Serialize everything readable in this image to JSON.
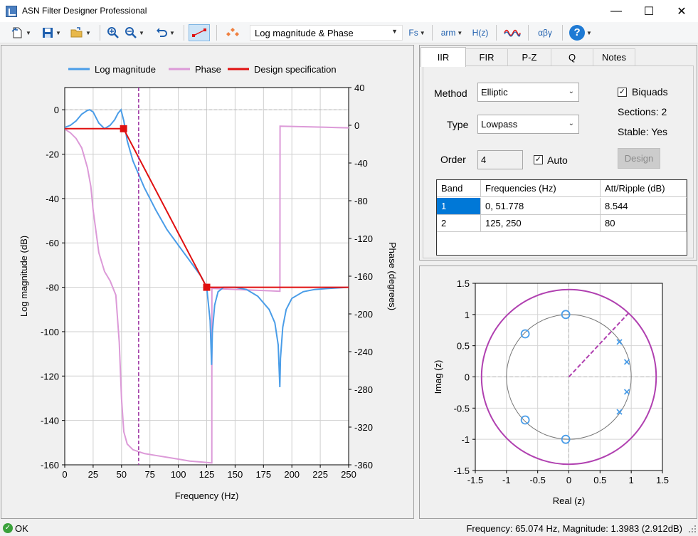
{
  "window": {
    "title": "ASN Filter Designer Professional"
  },
  "toolbar": {
    "view_mode": "Log magnitude & Phase",
    "fs_label": "Fs",
    "arm_label": "arm",
    "hz_label": "H(z)",
    "greek_label": "αβγ",
    "help_label": "?"
  },
  "tabs": [
    "IIR",
    "FIR",
    "P-Z",
    "Q",
    "Notes"
  ],
  "iir": {
    "method_label": "Method",
    "method_value": "Elliptic",
    "type_label": "Type",
    "type_value": "Lowpass",
    "order_label": "Order",
    "order_value": "4",
    "auto_label": "Auto",
    "biquads_label": "Biquads",
    "sections_text": "Sections: 2",
    "stable_text": "Stable: Yes",
    "design_label": "Design"
  },
  "spec_table": {
    "headers": [
      "Band",
      "Frequencies (Hz)",
      "Att/Ripple (dB)"
    ],
    "rows": [
      [
        "1",
        "0, 51.778",
        "8.544"
      ],
      [
        "2",
        "125, 250",
        "80"
      ]
    ]
  },
  "status": {
    "ok_text": "OK",
    "readout": "Frequency: 65.074 Hz, Magnitude: 1.3983 (2.912dB)"
  },
  "chart_data": [
    {
      "type": "line",
      "legend": [
        "Log magnitude",
        "Phase",
        "Design specification"
      ],
      "legend_position": "top",
      "xlabel": "Frequency (Hz)",
      "ylabel": "Log magnitude (dB)",
      "y2label": "Phase (degrees)",
      "xlim": [
        0,
        250
      ],
      "ylim": [
        -160,
        10
      ],
      "y2lim": [
        -360,
        40
      ],
      "xticks": [
        "0",
        "25",
        "50",
        "75",
        "100",
        "125",
        "150",
        "175",
        "200",
        "225",
        "250"
      ],
      "yticks": [
        "0",
        "-20",
        "-40",
        "-60",
        "-80",
        "-100",
        "-120",
        "-140",
        "-160"
      ],
      "y2ticks": [
        "40",
        "0",
        "-40",
        "-80",
        "-120",
        "-160",
        "-200",
        "-240",
        "-280",
        "-320",
        "-360"
      ],
      "grid": true,
      "cursor_x": 65.074,
      "colors": {
        "magnitude": "#4a9de8",
        "phase": "#dc9ad8",
        "spec": "#e01010",
        "cursor": "#9b30a0"
      },
      "series": [
        {
          "name": "Log magnitude",
          "x": [
            0,
            5,
            10,
            15,
            20,
            22,
            25,
            30,
            35,
            40,
            44,
            47,
            49.5,
            52,
            55,
            60,
            70,
            80,
            90,
            100,
            110,
            120,
            125,
            128,
            129.3,
            130,
            132,
            135,
            140,
            150,
            160,
            170,
            180,
            185,
            188,
            189.4,
            190,
            192,
            195,
            200,
            210,
            220,
            230,
            240,
            250
          ],
          "y": [
            -8,
            -7,
            -5,
            -2,
            -0.3,
            0,
            -1,
            -6,
            -8.5,
            -7,
            -4.5,
            -1.5,
            0,
            -5,
            -14,
            -23,
            -35,
            -45,
            -54,
            -61,
            -68,
            -75,
            -80,
            -95,
            -115,
            -100,
            -88,
            -82,
            -80,
            -80,
            -81,
            -84,
            -90,
            -96,
            -106,
            -125,
            -112,
            -98,
            -90,
            -85,
            -82,
            -81,
            -80.6,
            -80.3,
            -80
          ]
        },
        {
          "name": "Phase",
          "x": [
            0,
            5,
            10,
            15,
            20,
            23,
            25,
            30,
            35,
            40,
            45,
            48,
            50,
            52,
            55,
            60,
            70,
            80,
            90,
            100,
            110,
            120,
            129.5,
            129.6,
            130,
            140,
            150,
            160,
            170,
            180,
            189.5,
            189.6,
            200,
            210,
            220,
            230,
            240,
            250
          ],
          "y": [
            -4,
            -8,
            -14,
            -24,
            -45,
            -65,
            -90,
            -135,
            -155,
            -165,
            -180,
            -230,
            -290,
            -325,
            -338,
            -344,
            -348,
            -350,
            -352,
            -354,
            -356,
            -357,
            -358,
            -172,
            -173,
            -173.5,
            -174,
            -174.5,
            -175,
            -175.5,
            -176,
            -1,
            -1.2,
            -1.5,
            -1.8,
            -2.1,
            -2.4,
            -2.7
          ]
        },
        {
          "name": "Design specification",
          "x": [
            0,
            51.778,
            125,
            250
          ],
          "y": [
            -8.544,
            -8.544,
            -80,
            -80
          ]
        }
      ]
    },
    {
      "type": "scatter",
      "xlabel": "Real (z)",
      "ylabel": "Imag (z)",
      "xlim": [
        -1.5,
        1.5
      ],
      "ylim": [
        -1.5,
        1.5
      ],
      "xticks": [
        "-1.5",
        "-1",
        "-0.5",
        "0",
        "0.5",
        "1",
        "1.5"
      ],
      "yticks": [
        "1.5",
        "1",
        "0.5",
        "0",
        "-0.5",
        "-1",
        "-1.5"
      ],
      "grid": true,
      "unit_circle_radius": 1,
      "outer_circle_radius": 1.4,
      "cursor_angle_deg": 46.9,
      "zeros": [
        [
          -0.05,
          1.0
        ],
        [
          -0.05,
          -1.0
        ],
        [
          -0.7,
          0.69
        ],
        [
          -0.7,
          -0.69
        ]
      ],
      "poles": [
        [
          0.81,
          0.56
        ],
        [
          0.93,
          0.24
        ],
        [
          0.93,
          -0.24
        ],
        [
          0.81,
          -0.56
        ]
      ],
      "colors": {
        "markers": "#4a9de8",
        "outer": "#b040b0",
        "unit": "#777777"
      }
    }
  ]
}
